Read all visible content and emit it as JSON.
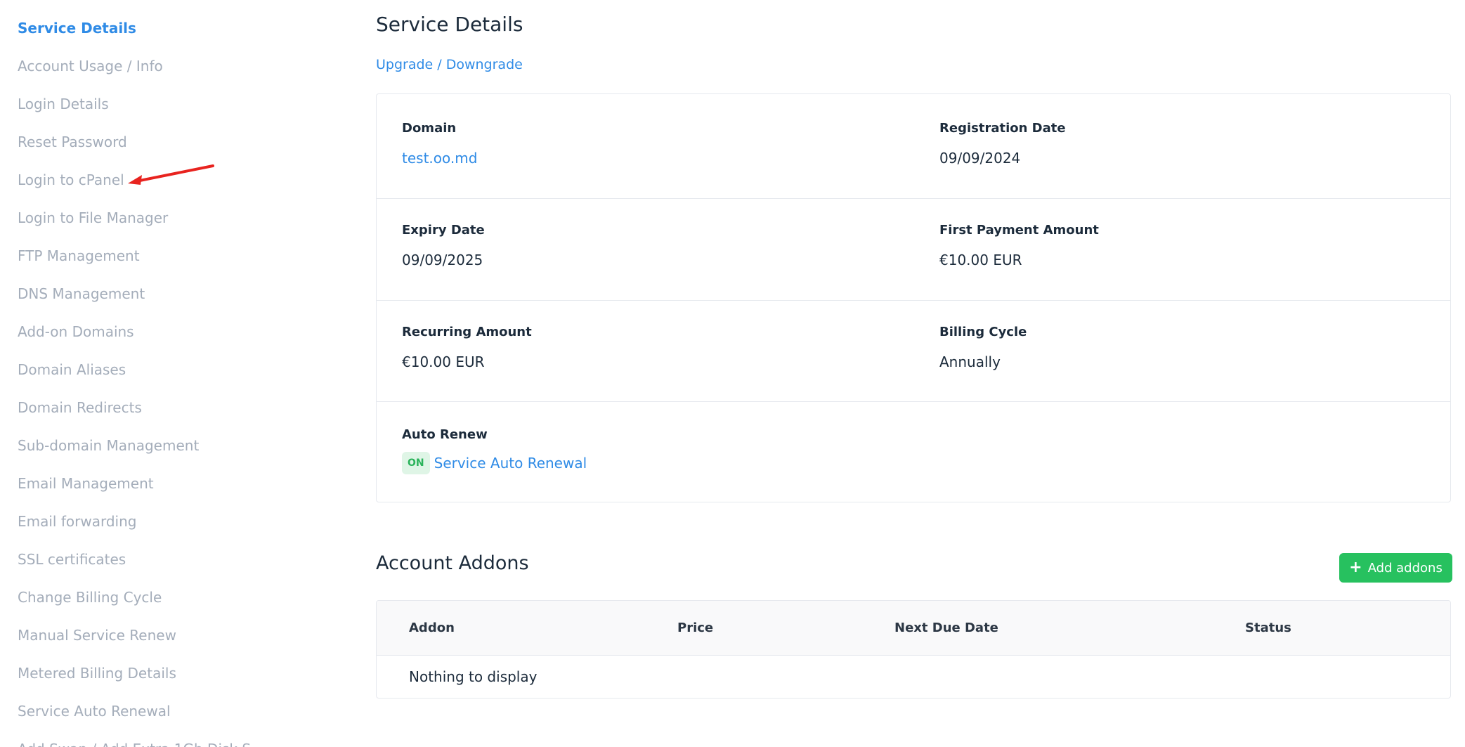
{
  "sidebar": {
    "items": [
      {
        "label": "Service Details",
        "active": true
      },
      {
        "label": "Account Usage / Info"
      },
      {
        "label": "Login Details"
      },
      {
        "label": "Reset Password"
      },
      {
        "label": "Login to cPanel"
      },
      {
        "label": "Login to File Manager"
      },
      {
        "label": "FTP Management"
      },
      {
        "label": "DNS Management"
      },
      {
        "label": "Add-on Domains"
      },
      {
        "label": "Domain Aliases"
      },
      {
        "label": "Domain Redirects"
      },
      {
        "label": "Sub-domain Management"
      },
      {
        "label": "Email Management"
      },
      {
        "label": "Email forwarding"
      },
      {
        "label": "SSL certificates"
      },
      {
        "label": "Change Billing Cycle"
      },
      {
        "label": "Manual Service Renew"
      },
      {
        "label": "Metered Billing Details"
      },
      {
        "label": "Service Auto Renewal"
      },
      {
        "label": "Add Swap / Add Extra 1Gb Disk S..."
      }
    ]
  },
  "annotation": {
    "arrow_color": "#e8231f",
    "points_to": "Login to cPanel"
  },
  "main": {
    "title": "Service Details",
    "upgrade_link": "Upgrade / Downgrade",
    "details": {
      "domain_label": "Domain",
      "domain_value": "test.oo.md",
      "registration_label": "Registration Date",
      "registration_value": "09/09/2024",
      "expiry_label": "Expiry Date",
      "expiry_value": "09/09/2025",
      "first_payment_label": "First Payment Amount",
      "first_payment_value": "€10.00 EUR",
      "recurring_label": "Recurring Amount",
      "recurring_value": "€10.00 EUR",
      "billing_cycle_label": "Billing Cycle",
      "billing_cycle_value": "Annually",
      "auto_renew_label": "Auto Renew",
      "auto_renew_badge": "ON",
      "auto_renew_link": "Service Auto Renewal"
    },
    "addons": {
      "title": "Account Addons",
      "add_button": "Add addons",
      "add_button_icon": "plus-icon",
      "columns": [
        "Addon",
        "Price",
        "Next Due Date",
        "Status"
      ],
      "empty_text": "Nothing to display"
    }
  },
  "colors": {
    "accent": "#2f8be6",
    "sidebar_text": "#a4adba",
    "success": "#27c15f",
    "badge_bg": "#dff5e6"
  }
}
